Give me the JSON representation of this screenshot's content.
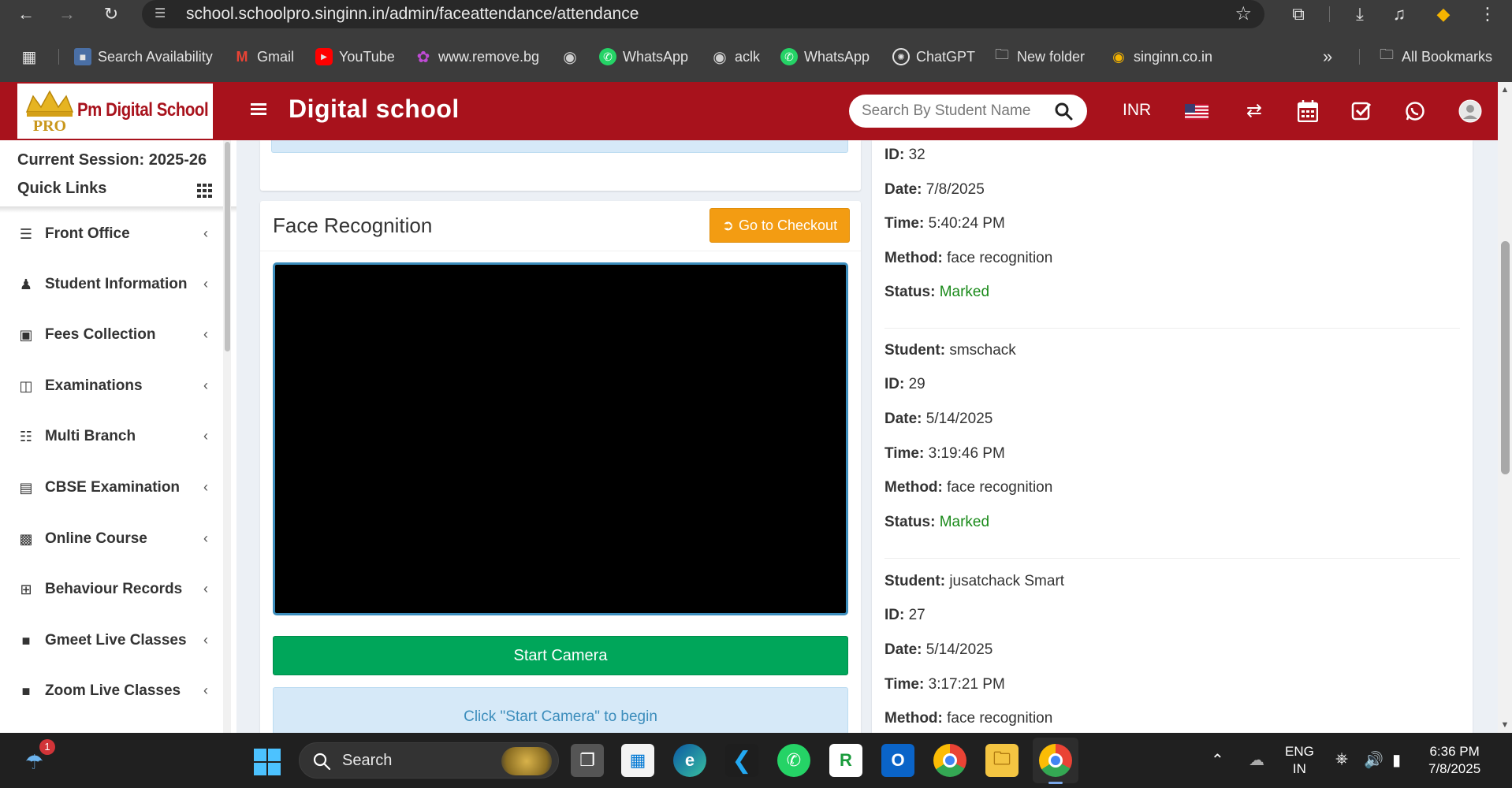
{
  "browser": {
    "url": "school.schoolpro.singinn.in/admin/faceattendance/attendance",
    "bookmarks": [
      "Search Availability",
      "Gmail",
      "YouTube",
      "www.remove.bg",
      "",
      "WhatsApp",
      "aclk",
      "WhatsApp",
      "ChatGPT",
      "New folder",
      "singinn.co.in"
    ],
    "overflow": "»",
    "all_bookmarks": "All Bookmarks"
  },
  "header": {
    "logo_text": "Pm Digital School",
    "logo_badge": "PRO",
    "title": "Digital school",
    "search_placeholder": "Search By Student Name",
    "currency": "INR",
    "colors": {
      "brand": "#a8121c",
      "success": "#00a65a",
      "warning": "#f39c12",
      "info": "#3c8dbc"
    }
  },
  "sidebar": {
    "session": "Current Session: 2025-26",
    "quick_links": "Quick Links",
    "items": [
      {
        "label": "Front Office",
        "icon": "front-office-icon"
      },
      {
        "label": "Student Information",
        "icon": "user-plus-icon"
      },
      {
        "label": "Fees Collection",
        "icon": "money-icon"
      },
      {
        "label": "Examinations",
        "icon": "map-icon"
      },
      {
        "label": "Multi Branch",
        "icon": "sitemap-icon"
      },
      {
        "label": "CBSE Examination",
        "icon": "document-icon"
      },
      {
        "label": "Online Course",
        "icon": "course-icon"
      },
      {
        "label": "Behaviour Records",
        "icon": "signpost-icon"
      },
      {
        "label": "Gmeet Live Classes",
        "icon": "video-camera-icon"
      },
      {
        "label": "Zoom Live Classes",
        "icon": "video-camera-icon"
      }
    ]
  },
  "face_card": {
    "title": "Face Recognition",
    "checkout_label": "Go to Checkout",
    "start_label": "Start Camera",
    "info_text": "Click \"Start Camera\" to begin"
  },
  "records": {
    "labels": {
      "student": "Student:",
      "id": "ID:",
      "date": "Date:",
      "time": "Time:",
      "method": "Method:",
      "status": "Status:"
    },
    "items": [
      {
        "id": "32",
        "date": "7/8/2025",
        "time": "5:40:24 PM",
        "method": "face recognition",
        "status": "Marked"
      },
      {
        "student": "smschack",
        "id": "29",
        "date": "5/14/2025",
        "time": "3:19:46 PM",
        "method": "face recognition",
        "status": "Marked"
      },
      {
        "student": "jusatchack Smart",
        "id": "27",
        "date": "5/14/2025",
        "time": "3:17:21 PM",
        "method": "face recognition"
      }
    ]
  },
  "taskbar": {
    "search_label": "Search",
    "notification_count": "1",
    "lang_top": "ENG",
    "lang_bottom": "IN",
    "time": "6:36 PM",
    "date": "7/8/2025"
  }
}
